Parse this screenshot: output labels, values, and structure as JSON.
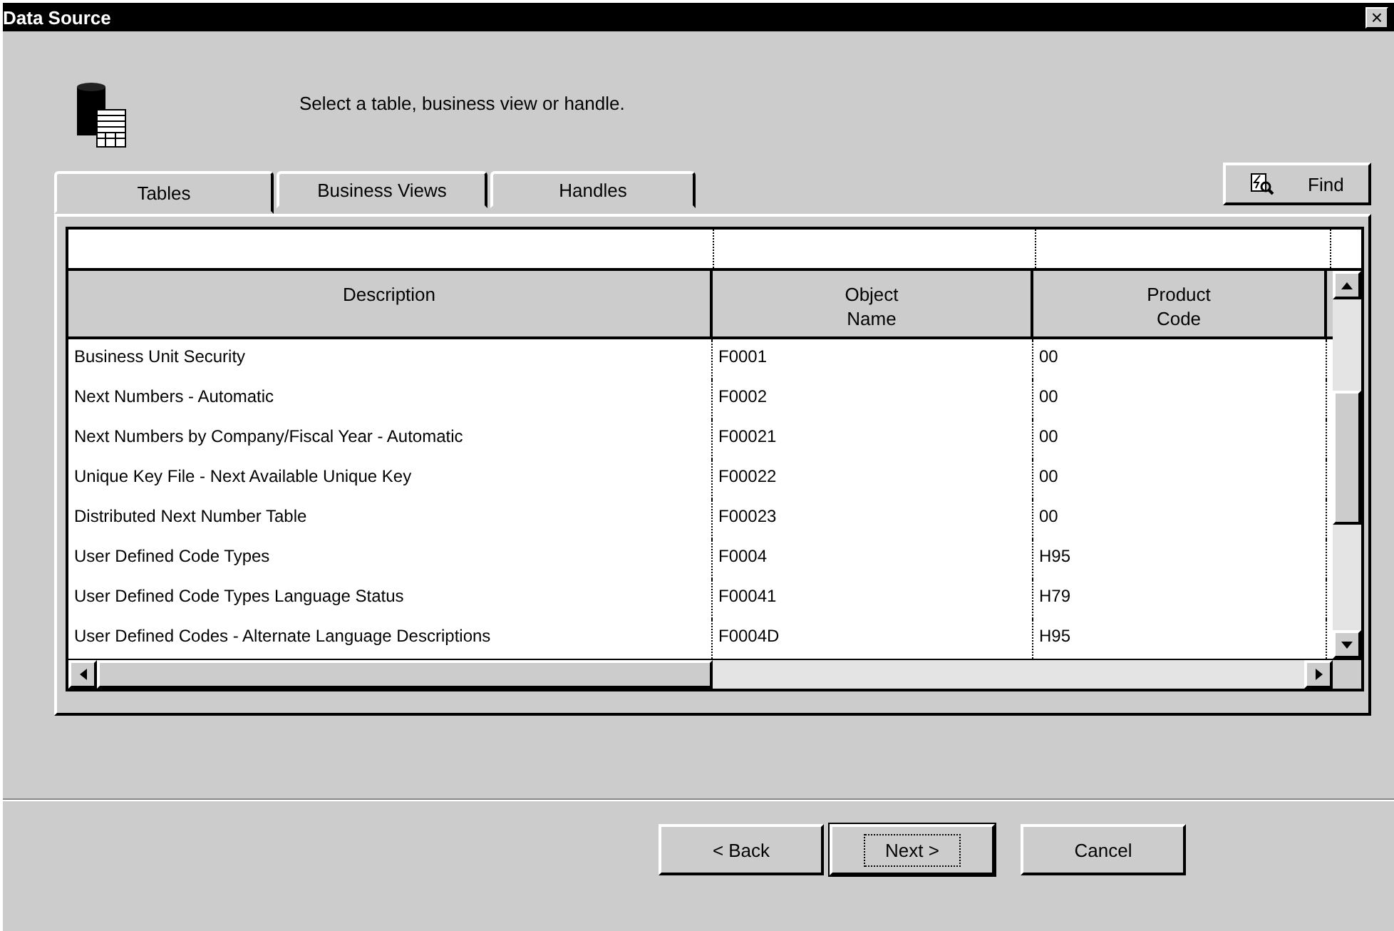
{
  "window": {
    "title": "Data Source",
    "close_glyph": "×"
  },
  "instruction": "Select a table, business view or handle.",
  "tabs": [
    {
      "label": "Tables",
      "selected": true
    },
    {
      "label": "Business Views",
      "selected": false
    },
    {
      "label": "Handles",
      "selected": false
    }
  ],
  "find_button": {
    "label": "Find"
  },
  "table": {
    "columns": [
      {
        "lines": [
          "Description"
        ]
      },
      {
        "lines": [
          "Object",
          "Name"
        ]
      },
      {
        "lines": [
          "Product",
          "Code"
        ]
      }
    ],
    "rows": [
      [
        "Business Unit Security",
        "F0001",
        "00"
      ],
      [
        "Next Numbers - Automatic",
        "F0002",
        "00"
      ],
      [
        "Next Numbers by Company/Fiscal Year - Automatic",
        "F00021",
        "00"
      ],
      [
        "Unique Key File - Next Available Unique Key",
        "F00022",
        "00"
      ],
      [
        "Distributed Next Number Table",
        "F00023",
        "00"
      ],
      [
        "User Defined Code Types",
        "F0004",
        "H95"
      ],
      [
        "User Defined Code Types Language Status",
        "F00041",
        "H79"
      ],
      [
        "User Defined Codes - Alternate Language Descriptions",
        "F0004D",
        "H95"
      ]
    ]
  },
  "buttons": [
    {
      "label": "< Back",
      "default": false
    },
    {
      "label": "Next >",
      "default": true
    },
    {
      "label": "Cancel",
      "default": false
    }
  ]
}
